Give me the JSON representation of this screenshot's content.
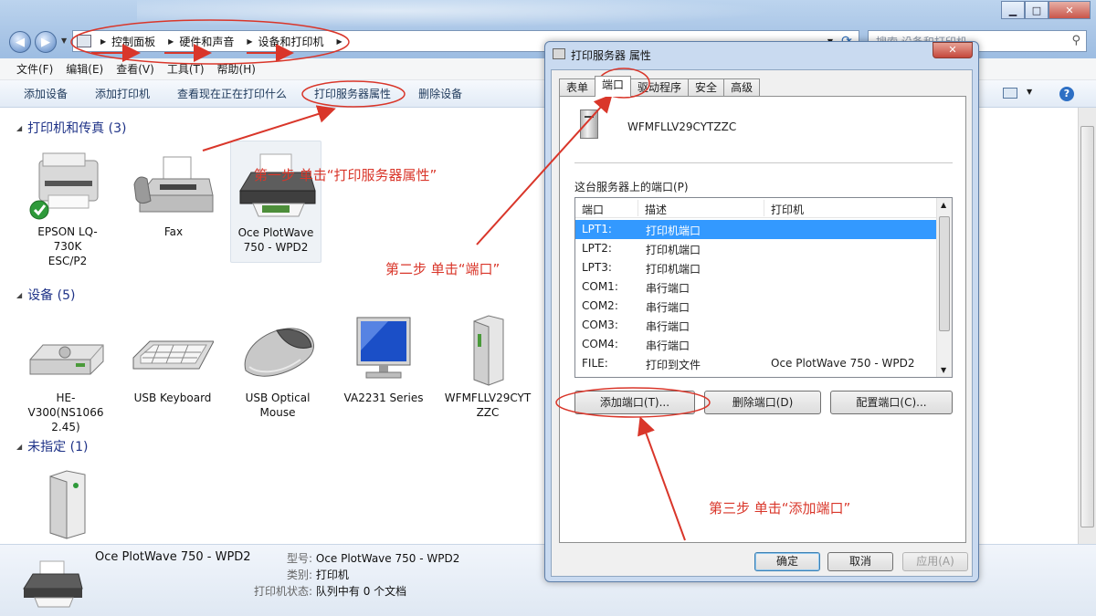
{
  "window": {
    "breadcrumb": [
      "控制面板",
      "硬件和声音",
      "设备和打印机"
    ],
    "search_placeholder": "搜索 设备和打印机"
  },
  "menu": [
    "文件(F)",
    "编辑(E)",
    "查看(V)",
    "工具(T)",
    "帮助(H)"
  ],
  "commands": [
    "添加设备",
    "添加打印机",
    "查看现在正在打印什么",
    "打印服务器属性",
    "删除设备"
  ],
  "groups": {
    "printers": {
      "label": "打印机和传真 (3)",
      "items": [
        "EPSON LQ-730K ESC/P2",
        "Fax",
        "Oce PlotWave 750 - WPD2"
      ]
    },
    "devices": {
      "label": "设备 (5)",
      "items": [
        "HE-V300(NS1066 2.45)",
        "USB Keyboard",
        "USB Optical Mouse",
        "VA2231 Series",
        "WFMFLLV29CYTZZC"
      ]
    },
    "unspecified": {
      "label": "未指定 (1)"
    }
  },
  "details": {
    "name": "Oce PlotWave 750 - WPD2",
    "model_label": "型号:",
    "model_value": "Oce PlotWave 750 - WPD2",
    "category_label": "类别:",
    "category_value": "打印机",
    "status_label": "打印机状态:",
    "status_value": "队列中有 0 个文档"
  },
  "dialog": {
    "title": "打印服务器 属性",
    "tabs": [
      "表单",
      "端口",
      "驱动程序",
      "安全",
      "高级"
    ],
    "server_name": "WFMFLLV29CYTZZC",
    "ports_label": "这台服务器上的端口(P)",
    "columns": [
      "端口",
      "描述",
      "打印机"
    ],
    "rows": [
      {
        "port": "LPT1:",
        "desc": "打印机端口",
        "printer": ""
      },
      {
        "port": "LPT2:",
        "desc": "打印机端口",
        "printer": ""
      },
      {
        "port": "LPT3:",
        "desc": "打印机端口",
        "printer": ""
      },
      {
        "port": "COM1:",
        "desc": "串行端口",
        "printer": ""
      },
      {
        "port": "COM2:",
        "desc": "串行端口",
        "printer": ""
      },
      {
        "port": "COM3:",
        "desc": "串行端口",
        "printer": ""
      },
      {
        "port": "COM4:",
        "desc": "串行端口",
        "printer": ""
      },
      {
        "port": "FILE:",
        "desc": "打印到文件",
        "printer": "Oce PlotWave 750 - WPD2"
      }
    ],
    "buttons": [
      "添加端口(T)...",
      "删除端口(D)",
      "配置端口(C)..."
    ],
    "footer": [
      "确定",
      "取消",
      "应用(A)"
    ]
  },
  "annotations": {
    "step1": "第一步  单击“打印服务器属性”",
    "step2": "第二步  单击“端口”",
    "step3": "第三步  单击“添加端口”"
  },
  "colors": {
    "annotation": "#d9362a",
    "selection": "#3399ff"
  }
}
